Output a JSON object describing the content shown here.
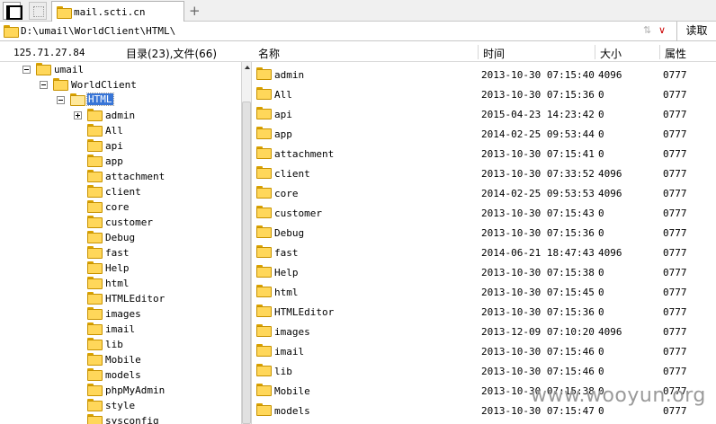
{
  "tabbar": {
    "tab_label": "mail.scti.cn",
    "add_label": "+"
  },
  "address": {
    "path": "D:\\umail\\WorldClient\\HTML\\",
    "up_glyph": "⇅",
    "dropdown_glyph": "∨",
    "read_label": "读取"
  },
  "header": {
    "ip": "125.71.27.84",
    "counts": "目录(23),文件(66)",
    "col_name": "名称",
    "col_time": "时间",
    "col_size": "大小",
    "col_attr": "属性"
  },
  "tree": [
    {
      "label": "umail",
      "indent": 0,
      "toggle": "minus"
    },
    {
      "label": "WorldClient",
      "indent": 1,
      "toggle": "minus"
    },
    {
      "label": "HTML",
      "indent": 2,
      "toggle": "minus",
      "selected": true
    },
    {
      "label": "admin",
      "indent": 3,
      "toggle": "plus"
    },
    {
      "label": "All",
      "indent": 3
    },
    {
      "label": "api",
      "indent": 3
    },
    {
      "label": "app",
      "indent": 3
    },
    {
      "label": "attachment",
      "indent": 3
    },
    {
      "label": "client",
      "indent": 3
    },
    {
      "label": "core",
      "indent": 3
    },
    {
      "label": "customer",
      "indent": 3
    },
    {
      "label": "Debug",
      "indent": 3
    },
    {
      "label": "fast",
      "indent": 3
    },
    {
      "label": "Help",
      "indent": 3
    },
    {
      "label": "html",
      "indent": 3
    },
    {
      "label": "HTMLEditor",
      "indent": 3
    },
    {
      "label": "images",
      "indent": 3
    },
    {
      "label": "imail",
      "indent": 3
    },
    {
      "label": "lib",
      "indent": 3
    },
    {
      "label": "Mobile",
      "indent": 3
    },
    {
      "label": "models",
      "indent": 3
    },
    {
      "label": "phpMyAdmin",
      "indent": 3
    },
    {
      "label": "style",
      "indent": 3
    },
    {
      "label": "sysconfig",
      "indent": 3
    }
  ],
  "files": [
    {
      "name": "admin",
      "time": "2013-10-30 07:15:40",
      "size": "4096",
      "attr": "0777"
    },
    {
      "name": "All",
      "time": "2013-10-30 07:15:36",
      "size": "0",
      "attr": "0777"
    },
    {
      "name": "api",
      "time": "2015-04-23 14:23:42",
      "size": "0",
      "attr": "0777"
    },
    {
      "name": "app",
      "time": "2014-02-25 09:53:44",
      "size": "0",
      "attr": "0777"
    },
    {
      "name": "attachment",
      "time": "2013-10-30 07:15:41",
      "size": "0",
      "attr": "0777"
    },
    {
      "name": "client",
      "time": "2013-10-30 07:33:52",
      "size": "4096",
      "attr": "0777"
    },
    {
      "name": "core",
      "time": "2014-02-25 09:53:53",
      "size": "4096",
      "attr": "0777"
    },
    {
      "name": "customer",
      "time": "2013-10-30 07:15:43",
      "size": "0",
      "attr": "0777"
    },
    {
      "name": "Debug",
      "time": "2013-10-30 07:15:36",
      "size": "0",
      "attr": "0777"
    },
    {
      "name": "fast",
      "time": "2014-06-21 18:47:43",
      "size": "4096",
      "attr": "0777"
    },
    {
      "name": "Help",
      "time": "2013-10-30 07:15:38",
      "size": "0",
      "attr": "0777"
    },
    {
      "name": "html",
      "time": "2013-10-30 07:15:45",
      "size": "0",
      "attr": "0777"
    },
    {
      "name": "HTMLEditor",
      "time": "2013-10-30 07:15:36",
      "size": "0",
      "attr": "0777"
    },
    {
      "name": "images",
      "time": "2013-12-09 07:10:20",
      "size": "4096",
      "attr": "0777"
    },
    {
      "name": "imail",
      "time": "2013-10-30 07:15:46",
      "size": "0",
      "attr": "0777"
    },
    {
      "name": "lib",
      "time": "2013-10-30 07:15:46",
      "size": "0",
      "attr": "0777"
    },
    {
      "name": "Mobile",
      "time": "2013-10-30 07:15:38",
      "size": "0",
      "attr": "0777"
    },
    {
      "name": "models",
      "time": "2013-10-30 07:15:47",
      "size": "0",
      "attr": "0777"
    }
  ],
  "watermark": "www.wooyun.org"
}
